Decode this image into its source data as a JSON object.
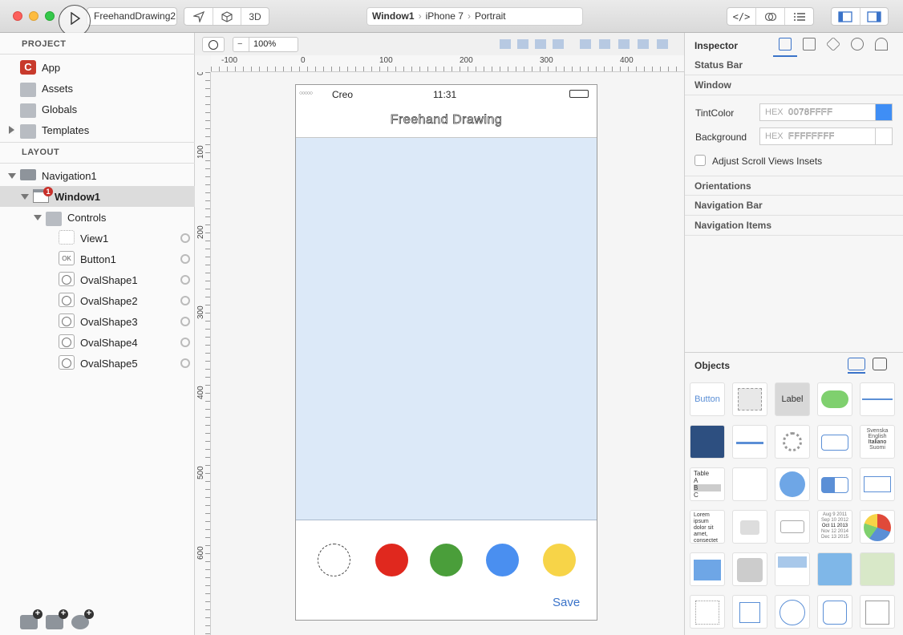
{
  "toolbar": {
    "scheme": "FreehandDrawing2",
    "mode_3d": "3D",
    "breadcrumb": {
      "window": "Window1",
      "device": "iPhone 7",
      "orientation": "Portrait"
    },
    "icons": [
      "play-icon",
      "location-arrow-icon",
      "cube-icon",
      "code-icon",
      "debug-icon",
      "list-icon",
      "left-panel-icon",
      "right-panel-icon"
    ]
  },
  "project": {
    "title": "PROJECT",
    "items": [
      {
        "label": "App",
        "icon": "app-icon"
      },
      {
        "label": "Assets",
        "icon": "assets-icon"
      },
      {
        "label": "Globals",
        "icon": "globals-icon"
      },
      {
        "label": "Templates",
        "icon": "templates-folder-icon"
      }
    ]
  },
  "layout": {
    "title": "LAYOUT",
    "items": [
      {
        "label": "Navigation1"
      },
      {
        "label": "Window1",
        "badge": "1"
      },
      {
        "label": "Controls"
      },
      {
        "label": "View1"
      },
      {
        "label": "Button1",
        "icon_text": "OK"
      },
      {
        "label": "OvalShape1"
      },
      {
        "label": "OvalShape2"
      },
      {
        "label": "OvalShape3"
      },
      {
        "label": "OvalShape4"
      },
      {
        "label": "OvalShape5"
      }
    ]
  },
  "canvas": {
    "zoom": "100%",
    "hruler_labels": [
      "-100",
      "0",
      "100",
      "200",
      "300",
      "400"
    ],
    "vruler_labels": [
      "0",
      "100",
      "200",
      "300",
      "400",
      "500",
      "600"
    ],
    "phone": {
      "carrier": "Creo",
      "time": "11:31",
      "title": "Freehand Drawing",
      "save": "Save",
      "colors": [
        "#ffffff",
        "#e0281e",
        "#4a9e3a",
        "#4a8ff0",
        "#f7d448"
      ]
    }
  },
  "inspector": {
    "title": "Inspector",
    "sections": {
      "status_bar": "Status Bar",
      "window": "Window",
      "orientations": "Orientations",
      "navigation_bar": "Navigation Bar",
      "navigation_items": "Navigation Items"
    },
    "tint_label": "TintColor",
    "tint_hex_label": "HEX",
    "tint_value": "0078FFFF",
    "tint_color": "#3f8ef5",
    "background_label": "Background",
    "background_hex_label": "HEX",
    "background_value": "FFFFFFFF",
    "adjust_label": "Adjust Scroll Views Insets"
  },
  "objects": {
    "title": "Objects",
    "button_label": "Button",
    "label_label": "Label",
    "table_words": [
      "Table",
      "A",
      "B",
      "C"
    ],
    "picker_words": [
      "Svenska",
      "English",
      "Italiano",
      "Suomi"
    ],
    "lorem": [
      "Lorem",
      "ipsum",
      "dolor sit",
      "amet,",
      "consectet"
    ],
    "dates": [
      "Aug  9 2011",
      "Sep 10 2012",
      "Oct 11 2013",
      "Nov 12 2014",
      "Dec 13 2015"
    ]
  }
}
